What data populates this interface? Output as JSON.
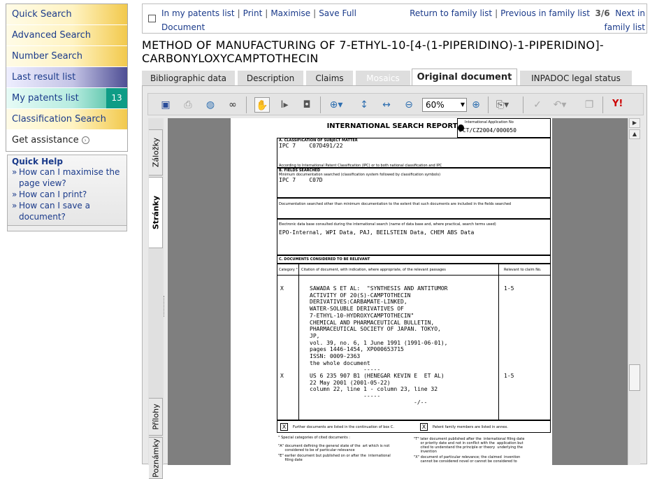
{
  "sidebar": {
    "items": [
      {
        "label": "Quick Search"
      },
      {
        "label": "Advanced Search"
      },
      {
        "label": "Number Search"
      },
      {
        "label": "Last result list"
      },
      {
        "label": "My patents list",
        "badge": "13"
      },
      {
        "label": "Classification Search"
      },
      {
        "label": "Get assistance"
      }
    ],
    "quick_help": {
      "title": "Quick Help",
      "links": [
        "How can I maximise the page view?",
        "How can I print?",
        "How can I save a document?"
      ]
    }
  },
  "topbar": {
    "in_patents_list": "In my patents list",
    "print": "Print",
    "maximise": "Maximise",
    "save": "Save Full Document",
    "return": "Return to family list",
    "previous": "Previous in family list",
    "page_current": "3",
    "page_total": "/6",
    "next": "Next in family list"
  },
  "document_title": "METHOD OF MANUFACTURING OF 7-ETHYL-10-[4-(1-PIPERIDINO)-1-PIPERIDINO]-CARBONYLOXYCAMPTOTHECIN",
  "tabs": [
    "Bibliographic data",
    "Description",
    "Claims",
    "Mosaics",
    "Original document",
    "INPADOC legal status"
  ],
  "viewer": {
    "zoom": "60%",
    "side_tabs": [
      "Záložky",
      "Stránky",
      "Přílohy",
      "Poznámky"
    ],
    "icons": [
      "save-icon",
      "print-icon",
      "email-icon",
      "search-binoculars-icon",
      "hand-tool-icon",
      "select-text-icon",
      "snapshot-icon",
      "zoom-in-tool-icon",
      "fit-page-icon",
      "fit-width-icon",
      "zoom-out-icon",
      "zoom-plus-icon",
      "rotate-icon",
      "spell-icon",
      "undo-icon",
      "copy-icon",
      "yahoo-toolbar-icon"
    ]
  },
  "report": {
    "title": "INTERNATIONAL SEARCH REPORT",
    "app_label": "International Application No",
    "app_no": "PCT/CZ2004/000050",
    "secA_label": "A. CLASSIFICATION OF SUBJECT MATTER",
    "secA_value": "IPC 7    C07D491/22",
    "secA_note": "According to International Patent Classification (IPC) or to both national classification and IPC",
    "secB_label": "B. FIELDS SEARCHED",
    "secB_note": "Minimum documentation searched  (classification system followed by classification symbols)",
    "secB_value": "IPC 7    C07D",
    "doc_other": "Documentation searched other than minimum documentation to the extent that such documents are included  in the fields searched",
    "electronic_label": "Electronic data base consulted during the  international search (name of data base and,  where practical, search terms used)",
    "electronic_value": "EPO-Internal, WPI Data, PAJ, BEILSTEIN Data, CHEM ABS Data",
    "secC_label": "C. DOCUMENTS CONSIDERED TO BE RELEVANT",
    "col_category": "Category °",
    "col_citation": "Citation of document, with indication,  where appropriate, of the relevant passages",
    "col_relevant": "Relevant to claim No.",
    "cit1_cat": "X",
    "cit1_text": "SAWADA S ET AL:  \"SYNTHESIS AND ANTITUMOR\nACTIVITY OF 20(S)-CAMPTOTHECIN\nDERIVATIVES:CARBAMATE-LINKED,\nWATER-SOLUBLE DERIVATIVES OF\n7-ETHYL-10-HYDROXYCAMPTOTHECIN\"\nCHEMICAL AND PHARMACEUTICAL BULLETIN,\nPHARMACEUTICAL SOCIETY OF JAPAN. TOKYO,\nJP,\nvol. 39, no. 6, 1 June 1991 (1991-06-01),\npages 1446-1454, XP000653715\nISSN: 0009-2363\nthe whole document\n                -----",
    "cit1_rel": "1-5",
    "cit2_cat": "X",
    "cit2_text": "US 6 235 907 B1 (HENEGAR KEVIN E  ET AL)\n22 May 2001 (2001-05-22)\ncolumn 22, line 1 - column 23, line 32\n                -----",
    "cit2_rel": "1-5",
    "cont": "-/--",
    "further_docs": "Further documents are listed in the  continuation of box C.",
    "family_docs": "Patent family members are listed in annex.",
    "special_cats": "° Special categories of cited documents :",
    "cat_A": "\"A\" document defining the general state of the  art which is not\n      considered to be of particular relevance",
    "cat_E": "\"E\" earlier document but published on or after the  international\n      filing date",
    "cat_T": "\"T\" later document published after the  international filing date\n      or priority date and not in conflict with the  application but\n      cited to understand the principle or theory  underlying the\n      invention",
    "cat_X": "\"X\" document of particular relevance; the claimed  invention\n      cannot be considered novel or cannot be considered to"
  }
}
